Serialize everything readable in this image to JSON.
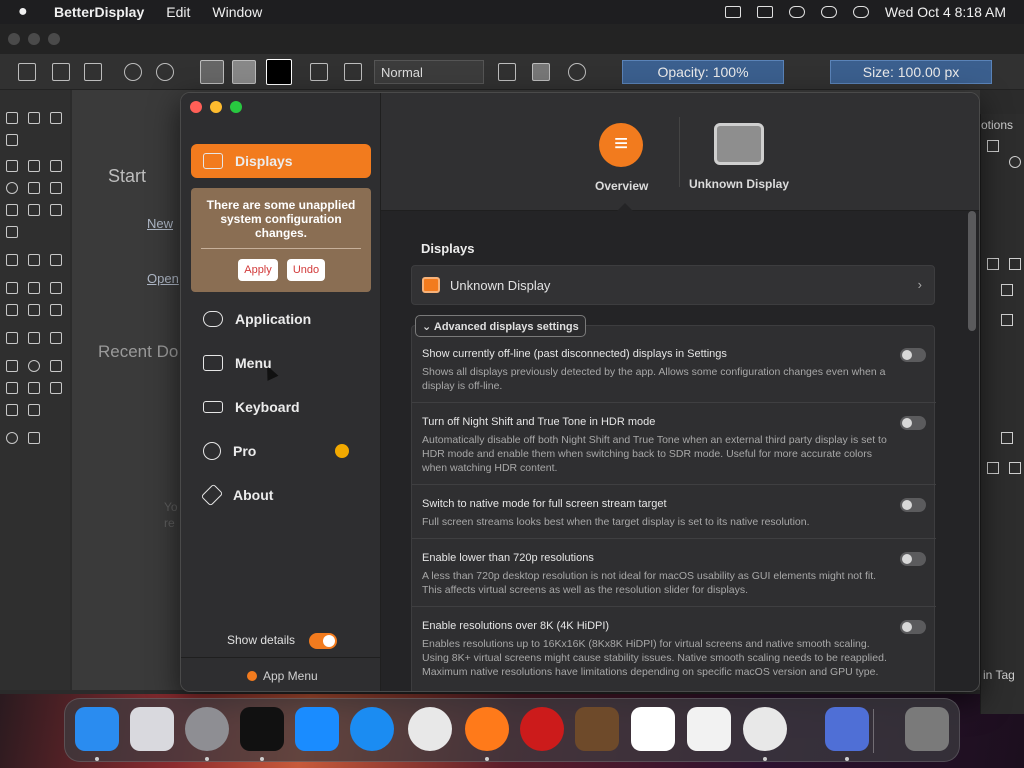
{
  "menubar": {
    "app_name": "BetterDisplay",
    "items": [
      "Edit",
      "Window"
    ],
    "datetime": "Wed Oct 4  8:18 AM"
  },
  "bg_app": {
    "blend_mode": "Normal",
    "opacity": "Opacity: 100%",
    "size": "Size: 100.00 px",
    "start": "Start",
    "new_link": "New",
    "open_link": "Open",
    "recent": "Recent Do",
    "right_tab": "otions",
    "tag_text": "in Tag",
    "faded_1": "Yo",
    "faded_2": "re"
  },
  "sidebar": {
    "items": [
      {
        "label": "Displays",
        "icon": "display-icon"
      },
      {
        "label": "Application",
        "icon": "toggles-icon"
      },
      {
        "label": "Menu",
        "icon": "menu-icon"
      },
      {
        "label": "Keyboard",
        "icon": "keyboard-icon"
      },
      {
        "label": "Pro",
        "icon": "badge-check-icon"
      },
      {
        "label": "About",
        "icon": "tag-icon"
      }
    ],
    "notice": "There are some unapplied system configuration changes.",
    "apply": "Apply",
    "undo": "Undo",
    "show_details": "Show details",
    "app_menu": "App Menu"
  },
  "header": {
    "tabs": [
      "Overview",
      "Unknown Display"
    ]
  },
  "content": {
    "section_title": "Displays",
    "display_name": "Unknown Display",
    "advanced_label": "Advanced displays settings",
    "settings": [
      {
        "title": "Show currently off-line (past disconnected) displays in Settings",
        "desc": "Shows all displays previously detected by the app. Allows some configuration changes even when a display is off-line."
      },
      {
        "title": "Turn off Night Shift and True Tone in HDR mode",
        "desc": "Automatically disable off both Night Shift and True Tone when an external third party display is set to HDR mode and enable them when switching back to SDR mode. Useful for more accurate colors when watching HDR content."
      },
      {
        "title": "Switch to native mode for full screen stream target",
        "desc": "Full screen streams looks best when the target display is set to its native resolution."
      },
      {
        "title": "Enable lower than 720p resolutions",
        "desc": "A less than 720p desktop resolution is not ideal for macOS usability as GUI elements might not fit. This affects virtual screens as well as the resolution slider for displays."
      },
      {
        "title": "Enable resolutions over 8K (4K HiDPI)",
        "desc": "Enables resolutions up to 16Kx16K (8Kx8K HiDPI) for virtual screens and native smooth scaling. Using 8K+ virtual screens might cause stability issues. Native smooth scaling needs to be reapplied. Maximum native resolutions have limitations depending on specific macOS version and GPU type."
      }
    ]
  },
  "dock": {
    "apps": [
      {
        "name": "finder-icon",
        "color": "#2a8cf0"
      },
      {
        "name": "launchpad-icon",
        "color": "#d9d9de"
      },
      {
        "name": "system-settings-icon",
        "color": "#8e8e93"
      },
      {
        "name": "terminal-icon",
        "color": "#111111"
      },
      {
        "name": "app-store-icon",
        "color": "#1a8cff"
      },
      {
        "name": "safari-icon",
        "color": "#1b8cf2"
      },
      {
        "name": "chrome-icon",
        "color": "#e8e8e8"
      },
      {
        "name": "firefox-icon",
        "color": "#ff7a1a"
      },
      {
        "name": "opera-icon",
        "color": "#cc1b1b"
      },
      {
        "name": "garageband-icon",
        "color": "#6e4a2a"
      },
      {
        "name": "vscode-icon",
        "color": "#ffffff"
      },
      {
        "name": "textedit-icon",
        "color": "#f2f2f2"
      },
      {
        "name": "krita-icon",
        "color": "#e8e8e8"
      },
      {
        "name": "betterdisplay-icon",
        "color": "#4f6fd6"
      },
      {
        "name": "trash-icon",
        "color": "#7a7a7a"
      }
    ]
  },
  "colors": {
    "accent": "#f27b1e",
    "notice_bg": "#8a6e53"
  }
}
